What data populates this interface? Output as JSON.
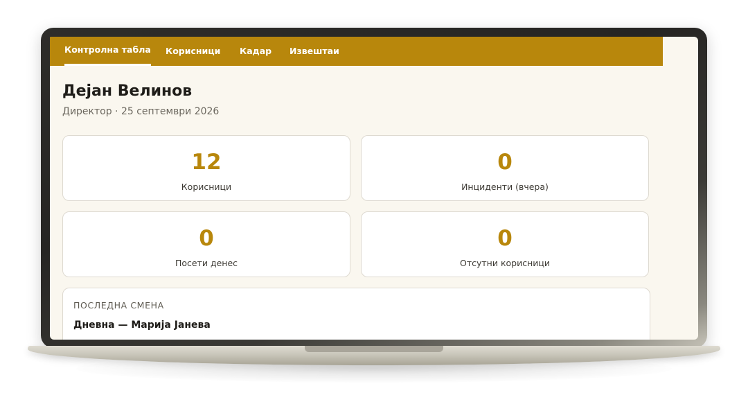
{
  "nav": {
    "tabs": [
      {
        "label": "Контролна табла",
        "active": true
      },
      {
        "label": "Корисници",
        "active": false
      },
      {
        "label": "Кадар",
        "active": false
      },
      {
        "label": "Извештаи",
        "active": false
      }
    ]
  },
  "header": {
    "name": "Дејан Велинов",
    "subtitle": "Директор · 25 септември 2026"
  },
  "stats": [
    {
      "value": "12",
      "label": "Корисници"
    },
    {
      "value": "0",
      "label": "Инциденти (вчера)"
    },
    {
      "value": "0",
      "label": "Посети денес"
    },
    {
      "value": "0",
      "label": "Отсутни корисници"
    }
  ],
  "last_shift": {
    "heading": "ПОСЛЕДНА СМЕНА",
    "value": "Дневна — Марија Јанева"
  },
  "colors": {
    "accent": "#b8870c",
    "background": "#faf7ef",
    "card": "#ffffff",
    "text": "#1f1d19"
  }
}
